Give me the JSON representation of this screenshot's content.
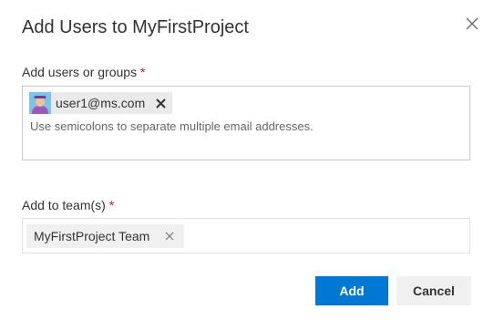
{
  "dialog": {
    "title": "Add Users to MyFirstProject"
  },
  "users_field": {
    "label": "Add users or groups",
    "required_marker": "*",
    "chips": [
      {
        "text": "user1@ms.com",
        "remove_icon": "close-icon"
      }
    ],
    "placeholder": "Use semicolons to separate multiple email addresses."
  },
  "teams_field": {
    "label": "Add to team(s)",
    "required_marker": "*",
    "chips": [
      {
        "text": "MyFirstProject Team",
        "remove_icon": "close-icon"
      }
    ]
  },
  "buttons": {
    "add": "Add",
    "cancel": "Cancel"
  },
  "colors": {
    "primary": "#0078d4",
    "required": "#e81123",
    "chip_background": "#eaeaea"
  }
}
